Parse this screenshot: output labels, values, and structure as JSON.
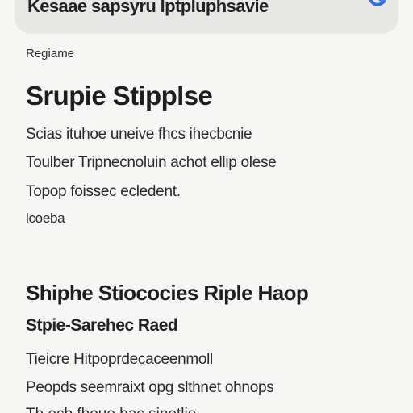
{
  "search": {
    "text": "Kesaae sapsyru lptpluphsavie",
    "icon": "siri-icon",
    "accent": "#2f6fe0"
  },
  "section_caption": "Regiame",
  "card": {
    "title": "Srupie Stipplse",
    "lines": [
      "Scias ituhoe uneive fhcs ihecbcnie",
      "Toulber Tripnecnoluin achot ellip olese",
      "Topop foissec ecledent.",
      "lcoeba"
    ]
  },
  "section2": {
    "title": "Shiphe Stiococies Riple Haop",
    "subtitle": "Stpie-Sarehec Raed",
    "lines": [
      "Tieicre Hitpoprdecaceenmoll",
      "Peopds seemraixt opg slthnet ohnops",
      "Th ecb fhoue bac sinetlie"
    ]
  }
}
